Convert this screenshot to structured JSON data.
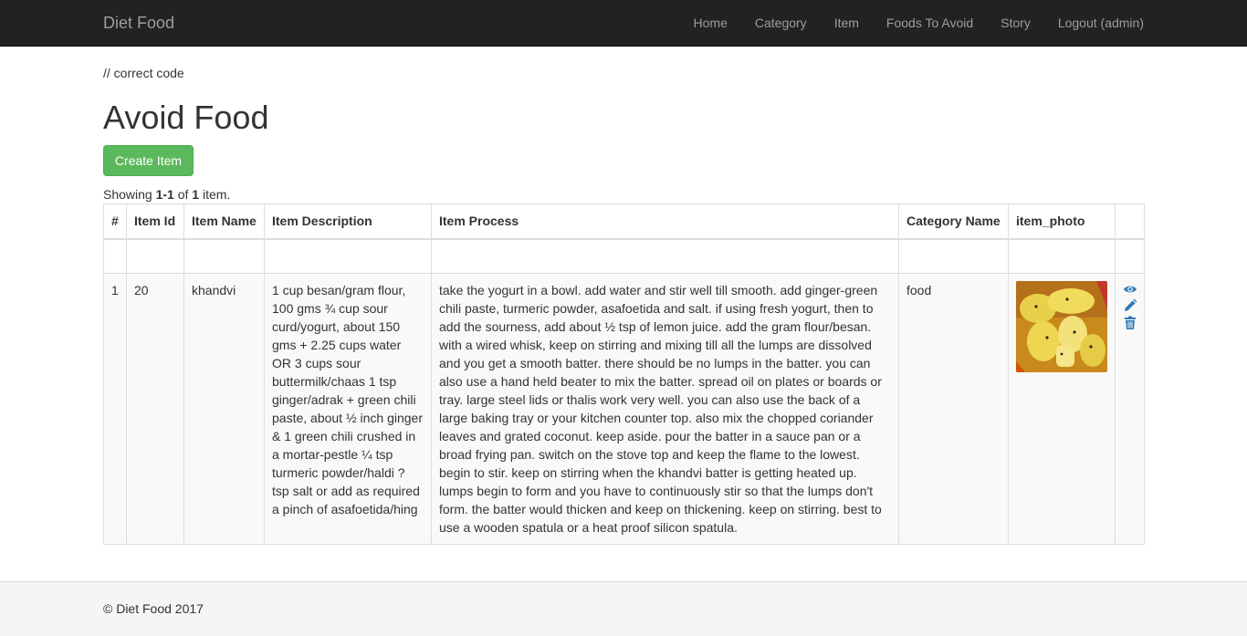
{
  "navbar": {
    "brand": "Diet Food",
    "items": [
      {
        "label": "Home"
      },
      {
        "label": "Category"
      },
      {
        "label": "Item"
      },
      {
        "label": "Foods To Avoid"
      },
      {
        "label": "Story"
      },
      {
        "label": "Logout (admin)"
      }
    ]
  },
  "page": {
    "code_note": "// correct code",
    "title": "Avoid Food",
    "create_button": "Create Item"
  },
  "summary": {
    "prefix": "Showing ",
    "range": "1-1",
    "of": " of ",
    "total": "1",
    "suffix": " item."
  },
  "table": {
    "headers": [
      "#",
      "Item Id",
      "Item Name",
      "Item Description",
      "Item Process",
      "Category Name",
      "item_photo",
      ""
    ],
    "rows": [
      {
        "index": "1",
        "item_id": "20",
        "item_name": "khandvi",
        "description": "1 cup besan/gram flour, 100 gms ¾ cup sour curd/yogurt, about 150 gms + 2.25 cups water OR 3 cups sour buttermilk/chaas 1 tsp ginger/adrak + green chili paste, about ½ inch ginger & 1 green chili crushed in a mortar-pestle ¼ tsp turmeric powder/haldi ? tsp salt or add as required a pinch of asafoetida/hing",
        "process": "take the yogurt in a bowl. add water and stir well till smooth. add ginger-green chili paste, turmeric powder, asafoetida and salt. if using fresh yogurt, then to add the sourness, add about ½ tsp of lemon juice. add the gram flour/besan. with a wired whisk, keep on stirring and mixing till all the lumps are dissolved and you get a smooth batter. there should be no lumps in the batter. you can also use a hand held beater to mix the batter. spread oil on plates or boards or tray. large steel lids or thalis work very well. you can also use the back of a large baking tray or your kitchen counter top. also mix the chopped coriander leaves and grated coconut. keep aside. pour the batter in a sauce pan or a broad frying pan. switch on the stove top and keep the flame to the lowest. begin to stir. keep on stirring when the khandvi batter is getting heated up. lumps begin to form and you have to continuously stir so that the lumps don't form. the batter would thicken and keep on thickening. keep on stirring. best to use a wooden spatula or a heat proof silicon spatula.",
        "category": "food",
        "photo_icon": "khandvi-photo",
        "actions": [
          "eye-icon",
          "pencil-icon",
          "trash-icon"
        ]
      }
    ]
  },
  "footer": {
    "text": "© Diet Food 2017"
  },
  "colors": {
    "navbar_bg": "#222222",
    "nav_text": "#9d9d9d",
    "button_green": "#5cb85c",
    "link_blue": "#337ab7",
    "footer_bg": "#f5f5f5"
  }
}
